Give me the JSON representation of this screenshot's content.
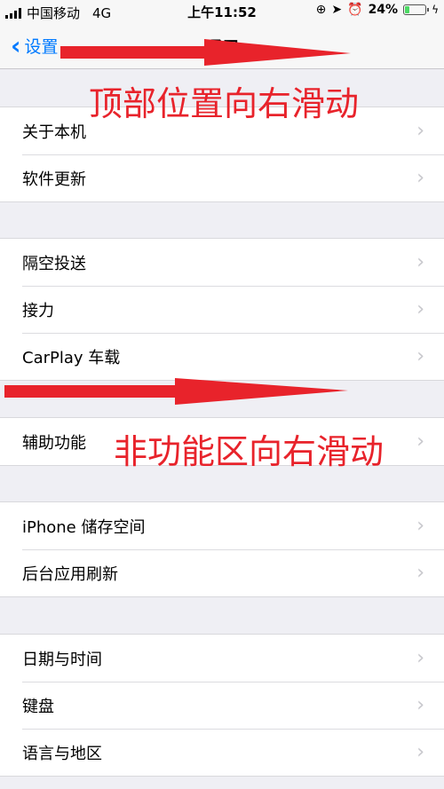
{
  "status_bar": {
    "carrier": "中国移动",
    "network": "4G",
    "time": "上午11:52",
    "battery_percent": "24%",
    "battery_level": 0.24
  },
  "nav": {
    "back_label": "设置",
    "title": "通用"
  },
  "groups": [
    {
      "items": [
        "关于本机",
        "软件更新"
      ]
    },
    {
      "items": [
        "隔空投送",
        "接力",
        "CarPlay 车载"
      ]
    },
    {
      "items": [
        "辅助功能"
      ]
    },
    {
      "items": [
        "iPhone 储存空间",
        "后台应用刷新"
      ]
    },
    {
      "items": [
        "日期与时间",
        "键盘",
        "语言与地区"
      ]
    }
  ],
  "annotations": {
    "top": "顶部位置向右滑动",
    "middle": "非功能区向右滑动"
  },
  "colors": {
    "ios_blue": "#007aff",
    "annotation_red": "#e8232b",
    "battery_green": "#4cd964"
  }
}
